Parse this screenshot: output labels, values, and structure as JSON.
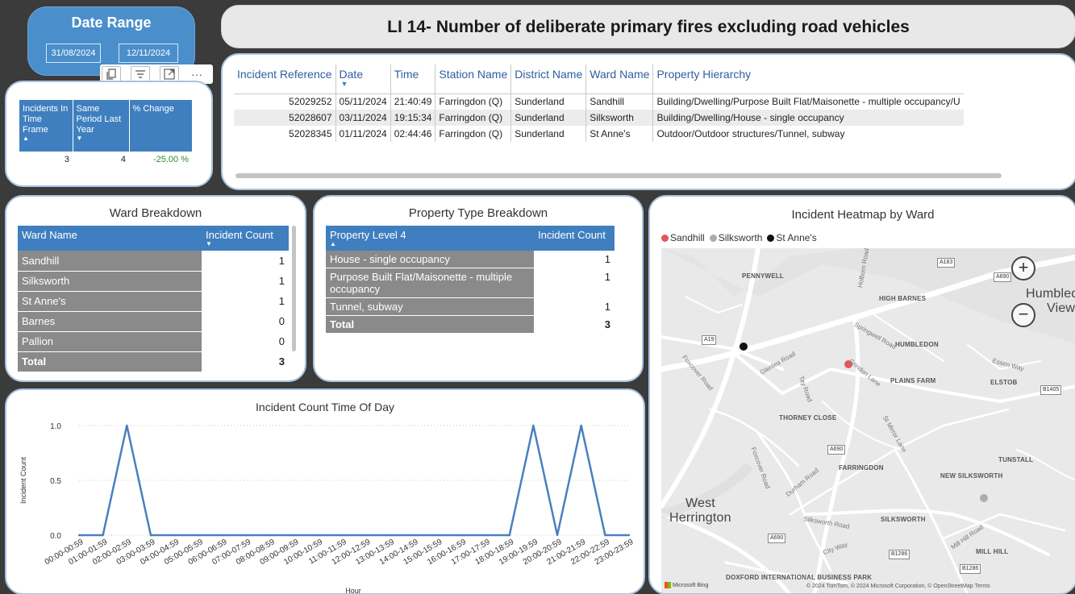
{
  "date_range": {
    "title": "Date Range",
    "from": "31/08/2024",
    "to": "12/11/2024"
  },
  "visual_toolbar": {
    "buttons": [
      "copy-icon",
      "filter-icon",
      "focus-mode-icon",
      "more-options-icon"
    ],
    "more_label": "···"
  },
  "kpi": {
    "headers": [
      "Incidents In Time Frame",
      "Same Period Last Year",
      "% Change"
    ],
    "values": [
      "3",
      "4",
      "-25.00 %"
    ],
    "change_color": "#2e8b2e"
  },
  "title": "LI 14- Number of deliberate primary fires excluding road vehicles",
  "incident_table": {
    "headers": [
      "Incident Reference",
      "Date",
      "Time",
      "Station Name",
      "District Name",
      "Ward Name",
      "Property Hierarchy"
    ],
    "rows": [
      [
        "52029252",
        "05/11/2024",
        "21:40:49",
        "Farringdon (Q)",
        "Sunderland",
        "Sandhill",
        "Building/Dwelling/Purpose Built Flat/Maisonette - multiple occupancy/U"
      ],
      [
        "52028607",
        "03/11/2024",
        "19:15:34",
        "Farringdon (Q)",
        "Sunderland",
        "Silksworth",
        "Building/Dwelling/House - single occupancy"
      ],
      [
        "52028345",
        "01/11/2024",
        "02:44:46",
        "Farringdon (Q)",
        "Sunderland",
        "St Anne's",
        "Outdoor/Outdoor structures/Tunnel, subway"
      ]
    ]
  },
  "ward_breakdown": {
    "title": "Ward Breakdown",
    "headers": [
      "Ward Name",
      "Incident Count"
    ],
    "rows": [
      [
        "Sandhill",
        "1"
      ],
      [
        "Silksworth",
        "1"
      ],
      [
        "St Anne's",
        "1"
      ],
      [
        "Barnes",
        "0"
      ],
      [
        "Pallion",
        "0"
      ]
    ],
    "total_label": "Total",
    "total_value": "3"
  },
  "property_breakdown": {
    "title": "Property Type Breakdown",
    "headers": [
      "Property Level 4",
      "Incident Count"
    ],
    "rows": [
      [
        "House - single occupancy",
        "1"
      ],
      [
        "Purpose Built Flat/Maisonette - multiple occupancy",
        "1"
      ],
      [
        "Tunnel, subway",
        "1"
      ]
    ],
    "total_label": "Total",
    "total_value": "3"
  },
  "map": {
    "title": "Incident Heatmap by Ward",
    "legend": [
      {
        "label": "Sandhill",
        "color": "#e05a5a"
      },
      {
        "label": "Silksworth",
        "color": "#b0aaa8"
      },
      {
        "label": "St Anne's",
        "color": "#111111"
      }
    ],
    "place_labels": [
      "PENNYWELL",
      "HIGH BARNES",
      "HUMBLEDON",
      "PLAINS FARM",
      "ELSTOB",
      "THORNEY CLOSE",
      "FARRINGDON",
      "TUNSTALL",
      "NEW SILKSWORTH",
      "SILKSWORTH",
      "MILL HILL",
      "DOXFORD INTERNATIONAL BUSINESS PARK"
    ],
    "big_labels": [
      "West",
      "Herrington",
      "Humbled",
      "View"
    ],
    "road_labels": [
      "Holborn Road",
      "Springwell Road",
      "Glenlea Road",
      "Tay Road",
      "Grindon Lane",
      "Foxcover Road",
      "Essen Way",
      "St Mirror Lane",
      "Durham Road",
      "Foxcover Road",
      "Silksworth Road",
      "City Way",
      "Mill Hill Road"
    ],
    "road_numbers": [
      "A183",
      "A690",
      "A19",
      "B1405",
      "A690",
      "A690",
      "B1286",
      "B1286"
    ],
    "bing_label": "Microsoft Bing",
    "credit": "© 2024 TomTom, © 2024 Microsoft Corporation, © OpenStreetMap  Terms",
    "zoom_in": "+",
    "zoom_out": "−"
  },
  "chart_data": {
    "type": "line",
    "title": "Incident Count Time Of Day",
    "xlabel": "Hour",
    "ylabel": "Incident Count",
    "categories": [
      "00:00-00:59",
      "01:00-01:59",
      "02:00-02:59",
      "03:00-03:59",
      "04:00-04:59",
      "05:00-05:59",
      "06:00-06:59",
      "07:00-07:59",
      "08:00-08:59",
      "09:00-09:59",
      "10:00-10:59",
      "11:00-11:59",
      "12:00-12:59",
      "13:00-13:59",
      "14:00-14:59",
      "15:00-15:59",
      "16:00-16:59",
      "17:00-17:59",
      "18:00-18:59",
      "19:00-19:59",
      "20:00-20:59",
      "21:00-21:59",
      "22:00-22:59",
      "23:00-23:59"
    ],
    "series": [
      {
        "values": [
          0,
          0,
          1,
          0,
          0,
          0,
          0,
          0,
          0,
          0,
          0,
          0,
          0,
          0,
          0,
          0,
          0,
          0,
          0,
          1,
          0,
          1,
          0,
          0
        ],
        "color": "#4a7fbf"
      }
    ],
    "yticks": [
      "0.0",
      "0.5",
      "1.0"
    ],
    "ylim": [
      0,
      1
    ],
    "grid": true
  }
}
